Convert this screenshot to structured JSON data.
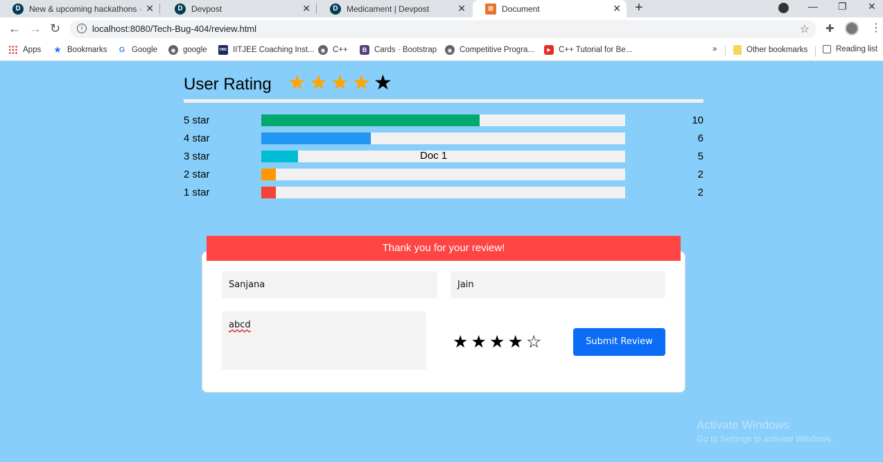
{
  "browser": {
    "tabs": [
      {
        "title": "New & upcoming hackathons · D",
        "favicon": "D",
        "active": false
      },
      {
        "title": "Devpost",
        "favicon": "D",
        "active": false
      },
      {
        "title": "Medicament | Devpost",
        "favicon": "D",
        "active": false
      },
      {
        "title": "Document",
        "favicon": "doc-icon",
        "active": true
      }
    ],
    "url": "localhost:8080/Tech-Bug-404/review.html",
    "new_tab_icon": "+",
    "bookmarks": [
      {
        "label": "Apps",
        "icon": "apps-grid-icon"
      },
      {
        "label": "Bookmarks",
        "icon": "star-icon"
      },
      {
        "label": "Google",
        "icon": "google-icon"
      },
      {
        "label": "google",
        "icon": "globe-icon"
      },
      {
        "label": "IITJEE Coaching Inst...",
        "icon": "vmc-icon",
        "icon_text": "VMC"
      },
      {
        "label": "C++",
        "icon": "globe-icon"
      },
      {
        "label": "Cards · Bootstrap",
        "icon": "bootstrap-icon",
        "icon_text": "B"
      },
      {
        "label": "Competitive Progra...",
        "icon": "globe-icon"
      },
      {
        "label": "C++ Tutorial for Be...",
        "icon": "youtube-icon"
      }
    ],
    "overflow": "»",
    "other_bookmarks": "Other bookmarks",
    "reading_list": "Reading list"
  },
  "rating": {
    "heading": "User Rating",
    "average_stars": 4,
    "max_stars": 5,
    "breakdown": [
      {
        "label": "5 star",
        "count": "10",
        "fraction": 0.6,
        "color": "#04aa6d"
      },
      {
        "label": "4 star",
        "count": "6",
        "fraction": 0.3,
        "color": "#2196f3"
      },
      {
        "label": "3 star",
        "count": "5",
        "fraction": 0.1,
        "color": "#00bcd4"
      },
      {
        "label": "2 star",
        "count": "2",
        "fraction": 0.04,
        "color": "#ff9800"
      },
      {
        "label": "1 star",
        "count": "2",
        "fraction": 0.04,
        "color": "#f44336"
      }
    ]
  },
  "document_title": "Doc 1",
  "review": {
    "banner": "Thank you for your review!",
    "banner_color": "#ff4444",
    "first_name": "Sanjana",
    "last_name": "Jain",
    "comment": "abcd",
    "selected_stars": 4,
    "submit_label": "Submit Review",
    "submit_color": "#0b6cf5"
  },
  "watermark": {
    "title": "Activate Windows",
    "subtitle": "Go to Settings to activate Windows."
  }
}
